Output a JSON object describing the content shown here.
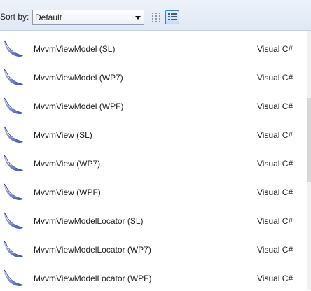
{
  "toolbar": {
    "sort_label": "Sort by:",
    "sort_value": "Default",
    "views": [
      {
        "name": "small-icons-view",
        "selected": false
      },
      {
        "name": "medium-icons-view",
        "selected": true
      }
    ]
  },
  "templates": [
    {
      "name": "MvvmViewModel (SL)",
      "language": "Visual C#",
      "icon": "feather-icon"
    },
    {
      "name": "MvvmViewModel (WP7)",
      "language": "Visual C#",
      "icon": "feather-icon"
    },
    {
      "name": "MvvmViewModel (WPF)",
      "language": "Visual C#",
      "icon": "feather-icon"
    },
    {
      "name": "MvvmView (SL)",
      "language": "Visual C#",
      "icon": "feather-icon"
    },
    {
      "name": "MvvmView (WP7)",
      "language": "Visual C#",
      "icon": "feather-icon"
    },
    {
      "name": "MvvmView (WPF)",
      "language": "Visual C#",
      "icon": "feather-icon"
    },
    {
      "name": "MvvmViewModelLocator (SL)",
      "language": "Visual C#",
      "icon": "feather-icon"
    },
    {
      "name": "MvvmViewModelLocator (WP7)",
      "language": "Visual C#",
      "icon": "feather-icon"
    },
    {
      "name": "MvvmViewModelLocator (WPF)",
      "language": "Visual C#",
      "icon": "feather-icon"
    }
  ]
}
